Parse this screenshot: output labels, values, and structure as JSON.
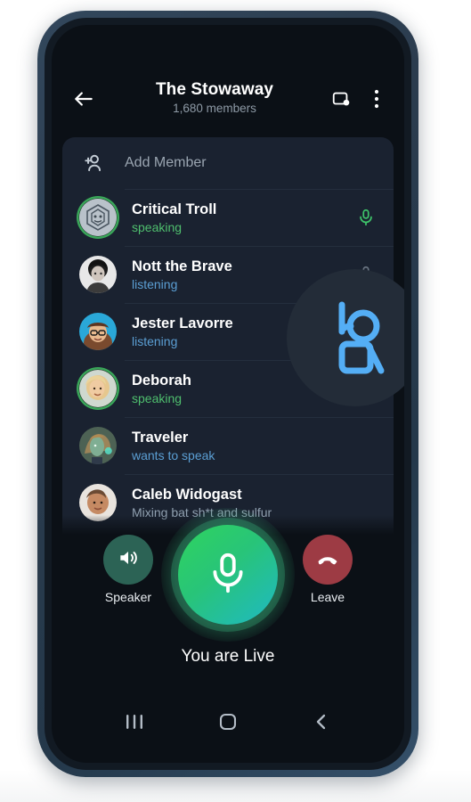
{
  "app": {
    "screen_name": "Voice Chat",
    "background_color": "#0b1016",
    "accent_green": "#4fbf6e",
    "accent_blue": "#5b9fd4",
    "leave_color": "#9d3b44",
    "speaker_color": "#2c6355"
  },
  "header": {
    "back_icon": "back-arrow-icon",
    "title": "The Stowaway",
    "subtitle": "1,680 members",
    "screen_share_icon": "screen-share-icon",
    "overflow_icon": "more-vertical-icon"
  },
  "add_member": {
    "icon": "add-person-icon",
    "label": "Add Member"
  },
  "members": [
    {
      "name": "Critical Troll",
      "status": "speaking",
      "status_type": "speaking",
      "mic_icon": "microphone-icon",
      "mic_state": "active",
      "avatar": "d20-die-logo",
      "ring": "speaking"
    },
    {
      "name": "Nott the Brave",
      "status": "listening",
      "status_type": "listening",
      "mic_icon": "microphone-icon",
      "mic_state": "muted",
      "avatar": "photo-portrait-grayscale",
      "ring": "none"
    },
    {
      "name": "Jester Lavorre",
      "status": "listening",
      "status_type": "listening",
      "mic_icon": "microphone-icon",
      "mic_state": "muted",
      "avatar": "photo-portrait-glasses",
      "ring": "none"
    },
    {
      "name": "Deborah",
      "status": "speaking",
      "status_type": "speaking",
      "mic_icon": "",
      "mic_state": "none",
      "avatar": "photo-portrait-blonde",
      "ring": "speaking"
    },
    {
      "name": "Traveler",
      "status": "wants to speak",
      "status_type": "wants",
      "mic_icon": "",
      "mic_state": "none",
      "avatar": "illustration-green-figure",
      "ring": "none"
    },
    {
      "name": "Caleb Widogast",
      "status": "Mixing bat sh*t and sulfur",
      "status_type": "plain",
      "mic_icon": "",
      "mic_state": "none",
      "avatar": "photo-portrait-man",
      "ring": "none"
    }
  ],
  "overlay": {
    "icon": "raise-hand-icon",
    "icon_color": "#54aef5",
    "bubble_color": "#232c38"
  },
  "controls": {
    "speaker_label": "Speaker",
    "speaker_icon": "speaker-volume-icon",
    "mic_icon": "microphone-icon",
    "leave_label": "Leave",
    "leave_icon": "hangup-phone-icon",
    "live_text": "You are Live"
  },
  "navbar": {
    "recents_icon": "recents-icon",
    "home_icon": "home-icon",
    "back_icon": "nav-back-icon"
  }
}
